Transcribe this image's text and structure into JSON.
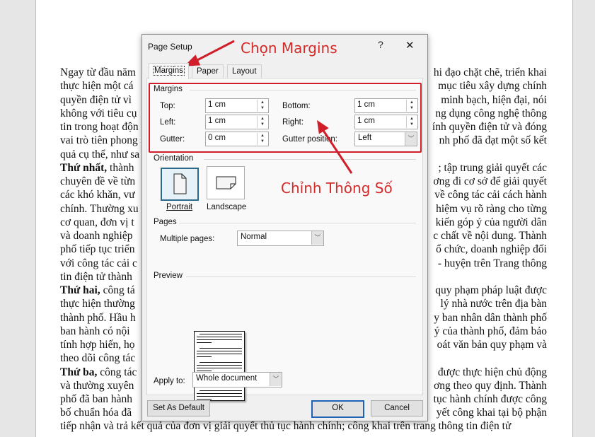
{
  "document": {
    "left_fragments": [
      "Ngay từ đầu năm",
      "thực hiện một cá",
      "quyền điện tử vì",
      "không với tiêu cụ",
      "tin trong hoạt độn",
      "vai trò tiên phong",
      "quả cụ thể, như sa",
      "Thứ nhất, thành",
      "chuyên đề về từn",
      "các khó khăn, vư",
      "chính. Thường xu",
      "cơ quan, đơn vị t",
      "và doanh nghiệp",
      "phố tiếp tục triển",
      "với công tác cải c",
      "tin điện tử thành",
      "Thứ hai, công tá",
      "thực hiện thường",
      "thành phố. Hầu h",
      "ban hành có nội",
      "tính hợp hiến, họ",
      "theo dõi công tác",
      "Thứ ba, công tác",
      "và thường xuyên",
      "phố đã ban hành",
      "bố chuẩn hóa đã"
    ],
    "right_fragments": [
      "hi đạo chặt chẽ, triển khai",
      "mục tiêu xây dựng chính",
      "minh bạch, hiện đại, nói",
      "ng dụng công nghệ thông",
      "ính quyền điện tử và đóng",
      "nh phố đã đạt một số kết",
      "",
      "; tập trung giải quyết các",
      "ơng đi cơ sở để giải quyết",
      "về công tác cải cách hành",
      "hiệm vụ rõ ràng cho từng",
      "kiến góp ý của người dân",
      "c chất về nội dung. Thành",
      "ổ chức, doanh nghiệp đối",
      "- huyện trên Trang thông",
      "",
      "quy phạm pháp luật được",
      "lý nhà nước trên địa bàn",
      "y ban nhân dân thành phố",
      "ý của thành phố, đảm bảo",
      "oát văn bản quy phạm và",
      "",
      "được thực hiện chủ động",
      "ơng theo quy định. Thành",
      "tục hành chính được công",
      "yết công khai tại bộ phận"
    ],
    "bold_prefixes": {
      "7": "Thứ nhất,",
      "16": "Thứ hai,",
      "22": "Thứ ba,"
    },
    "last_line": "tiếp nhận và trả kết quả của đơn vị giải quyết thủ tục hành chính; công khai trên trang thông tin điện tử"
  },
  "dialog": {
    "title": "Page Setup",
    "help": "?",
    "close": "✕",
    "tabs": [
      "Margins",
      "Paper",
      "Layout"
    ],
    "active_tab": "Margins",
    "margins": {
      "heading": "Margins",
      "top_label": "Top:",
      "top_value": "1 cm",
      "bottom_label": "Bottom:",
      "bottom_value": "1 cm",
      "left_label": "Left:",
      "left_value": "1 cm",
      "right_label": "Right:",
      "right_value": "1 cm",
      "gutter_label": "Gutter:",
      "gutter_value": "0 cm",
      "gutter_position_label": "Gutter position:",
      "gutter_position_value": "Left"
    },
    "orientation": {
      "heading": "Orientation",
      "portrait": "Portrait",
      "landscape": "Landscape",
      "selected": "Portrait"
    },
    "pages": {
      "heading": "Pages",
      "multiple_label": "Multiple pages:",
      "multiple_value": "Normal"
    },
    "preview": {
      "heading": "Preview"
    },
    "apply": {
      "label": "Apply to:",
      "value": "Whole document"
    },
    "buttons": {
      "default": "Set As Default",
      "ok": "OK",
      "cancel": "Cancel"
    }
  },
  "annotations": {
    "choose_margins": "Chọn Margins",
    "adjust_params": "Chỉnh Thông Số",
    "color": "#d42a2a"
  }
}
